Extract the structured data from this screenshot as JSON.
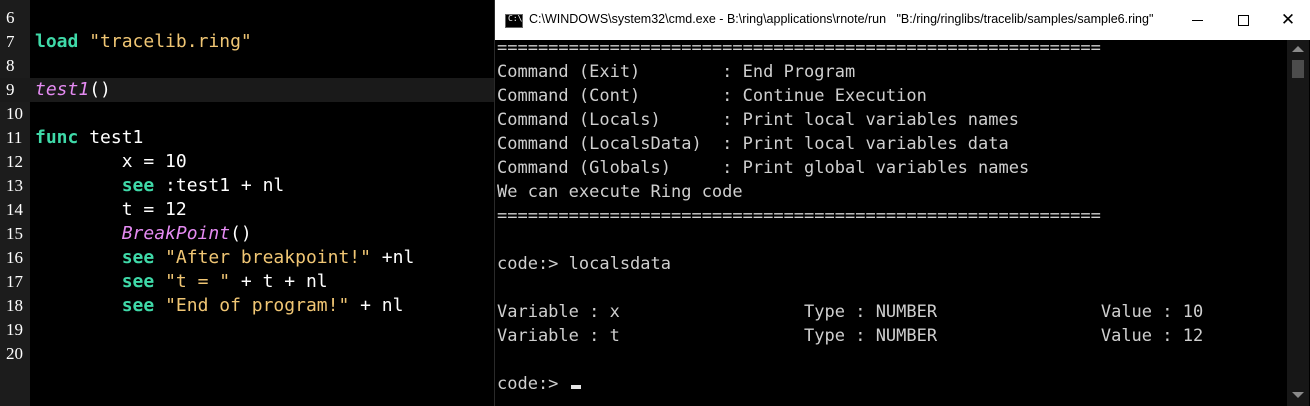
{
  "editor": {
    "lines": [
      {
        "num": "6",
        "code": ""
      },
      {
        "num": "7",
        "code": [
          {
            "t": "load",
            "c": "kw"
          },
          {
            "t": " "
          },
          {
            "t": "\"tracelib.ring\"",
            "c": "str"
          }
        ]
      },
      {
        "num": "8",
        "code": ""
      },
      {
        "num": "9",
        "code": [
          {
            "t": "test1",
            "c": "fn"
          },
          {
            "t": "()"
          }
        ],
        "current": true
      },
      {
        "num": "10",
        "code": ""
      },
      {
        "num": "11",
        "code": [
          {
            "t": "func",
            "c": "kw"
          },
          {
            "t": " test1"
          }
        ]
      },
      {
        "num": "12",
        "code": [
          {
            "t": "        x = 10"
          }
        ]
      },
      {
        "num": "13",
        "code": [
          {
            "t": "        "
          },
          {
            "t": "see",
            "c": "kw"
          },
          {
            "t": " :test1 + nl"
          }
        ]
      },
      {
        "num": "14",
        "code": [
          {
            "t": "        t = 12"
          }
        ]
      },
      {
        "num": "15",
        "code": [
          {
            "t": "        "
          },
          {
            "t": "BreakPoint",
            "c": "fn"
          },
          {
            "t": "()"
          }
        ]
      },
      {
        "num": "16",
        "code": [
          {
            "t": "        "
          },
          {
            "t": "see",
            "c": "kw"
          },
          {
            "t": " "
          },
          {
            "t": "\"After breakpoint!\"",
            "c": "str"
          },
          {
            "t": " +nl"
          }
        ]
      },
      {
        "num": "17",
        "code": [
          {
            "t": "        "
          },
          {
            "t": "see",
            "c": "kw"
          },
          {
            "t": " "
          },
          {
            "t": "\"t = \"",
            "c": "str"
          },
          {
            "t": " + t + nl"
          }
        ]
      },
      {
        "num": "18",
        "code": [
          {
            "t": "        "
          },
          {
            "t": "see",
            "c": "kw"
          },
          {
            "t": " "
          },
          {
            "t": "\"End of program!\"",
            "c": "str"
          },
          {
            "t": " + nl"
          }
        ]
      },
      {
        "num": "19",
        "code": ""
      },
      {
        "num": "20",
        "code": ""
      }
    ]
  },
  "console_window": {
    "title": "C:\\WINDOWS\\system32\\cmd.exe - B:\\ring\\applications\\rnote/run   \"B:/ring/ringlibs/tracelib/samples/sample6.ring\"",
    "icon_label": "C:\\",
    "lines": [
      "===========================================================",
      "Command (Exit)        : End Program",
      "Command (Cont)        : Continue Execution",
      "Command (Locals)      : Print local variables names",
      "Command (LocalsData)  : Print local variables data",
      "Command (Globals)     : Print global variables names",
      "We can execute Ring code",
      "===========================================================",
      "",
      "code:> localsdata",
      "",
      "Variable : x                  Type : NUMBER                Value : 10",
      "Variable : t                  Type : NUMBER                Value : 12",
      "",
      "code:> "
    ]
  },
  "colors": {
    "keyword": "#3fd9a8",
    "string": "#f0c674",
    "function": "#e58bf2",
    "console_text": "#cfcfcf"
  }
}
